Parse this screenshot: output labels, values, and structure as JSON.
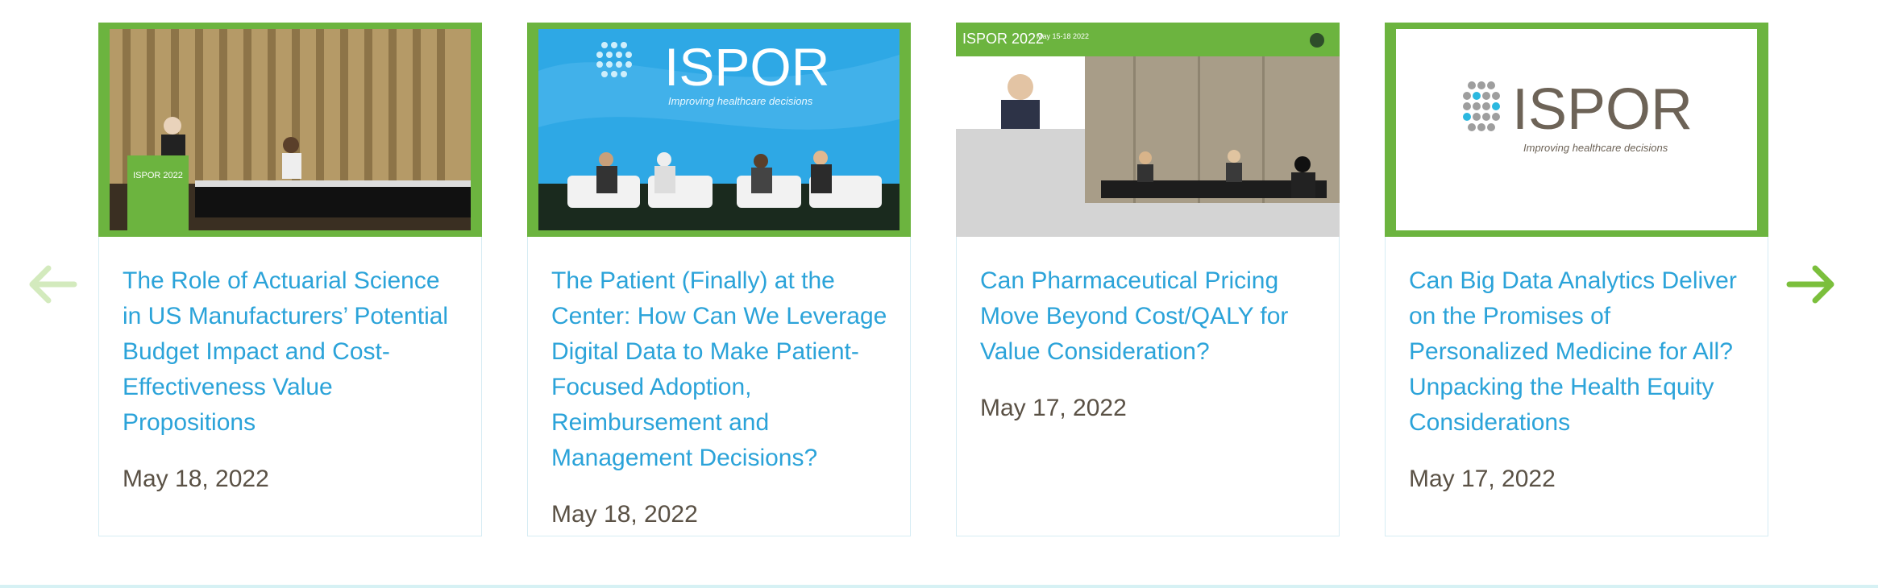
{
  "carousel": {
    "prev_icon": "arrow-left-icon",
    "next_icon": "arrow-right-icon",
    "colors": {
      "accent_green": "#7bbf3c",
      "title_blue": "#2ba3d9",
      "date_gray": "#5a5145",
      "border": "#d6ecf4"
    },
    "cards": [
      {
        "title": "The Role of Actuarial Science in US Manufacturers’ Potential Budget Impact and Cost-Effectiveness Value Propositions",
        "date": "May 18, 2022",
        "podium_label": "ISPOR 2022"
      },
      {
        "title": "The Patient (Finally) at the Center: How Can We Leverage Digital Data to Make Patient-Focused Adoption, Reimbursement and Management Decisions?",
        "date": "May 18, 2022",
        "logo_text": "ISPOR",
        "tagline": "Improving healthcare decisions"
      },
      {
        "title": "Can Pharmaceutical Pricing Move Beyond Cost/QALY for Value Consideration?",
        "date": "May 17, 2022",
        "banner_text": "ISPOR 2022",
        "banner_dates": "May 15-18 2022"
      },
      {
        "title": "Can Big Data Analytics Deliver on the Promises of Personalized Medicine for All? Unpacking the Health Equity Considerations",
        "date": "May 17, 2022",
        "logo_text": "ISPOR",
        "tagline": "Improving healthcare decisions"
      }
    ]
  }
}
